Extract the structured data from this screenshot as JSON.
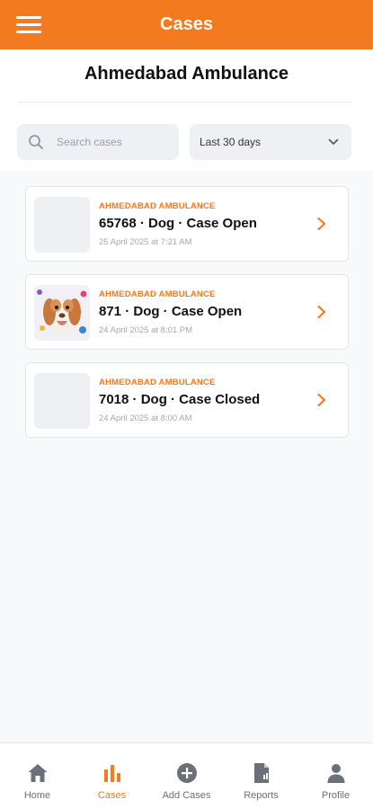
{
  "header": {
    "title": "Cases"
  },
  "organization": {
    "name": "Ahmedabad Ambulance"
  },
  "search": {
    "placeholder": "Search cases"
  },
  "filter": {
    "selected": "Last 30 days"
  },
  "cases": [
    {
      "org": "AHMEDABAD AMBULANCE",
      "title": "65768 · Dog · Case Open",
      "date": "25 April 2025 at 7:21 AM",
      "has_photo": false
    },
    {
      "org": "AHMEDABAD AMBULANCE",
      "title": "871 · Dog · Case Open",
      "date": "24 April 2025 at 8:01 PM",
      "has_photo": true
    },
    {
      "org": "AHMEDABAD AMBULANCE",
      "title": "7018 · Dog · Case Closed",
      "date": "24 April 2025 at 8:00 AM",
      "has_photo": false
    }
  ],
  "nav": {
    "items": [
      {
        "label": "Home",
        "icon": "home-icon",
        "active": false
      },
      {
        "label": "Cases",
        "icon": "bar-chart-icon",
        "active": true
      },
      {
        "label": "Add Cases",
        "icon": "add-circle-icon",
        "active": false
      },
      {
        "label": "Reports",
        "icon": "report-icon",
        "active": false
      },
      {
        "label": "Profile",
        "icon": "person-icon",
        "active": false
      }
    ]
  },
  "colors": {
    "accent": "#f47a20",
    "inactive": "#6b7079",
    "background": "#f8f9fb"
  }
}
